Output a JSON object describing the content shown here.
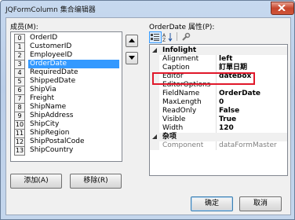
{
  "window": {
    "title": "JQFormColumn 集合编辑器"
  },
  "members": {
    "label": "成员(M):",
    "items": [
      {
        "index": "0",
        "name": "OrderID"
      },
      {
        "index": "1",
        "name": "CustomerID"
      },
      {
        "index": "2",
        "name": "EmployeeID"
      },
      {
        "index": "3",
        "name": "OrderDate"
      },
      {
        "index": "4",
        "name": "RequiredDate"
      },
      {
        "index": "5",
        "name": "ShippedDate"
      },
      {
        "index": "6",
        "name": "ShipVia"
      },
      {
        "index": "7",
        "name": "Freight"
      },
      {
        "index": "8",
        "name": "ShipName"
      },
      {
        "index": "9",
        "name": "ShipAddress"
      },
      {
        "index": "10",
        "name": "ShipCity"
      },
      {
        "index": "11",
        "name": "ShipRegion"
      },
      {
        "index": "12",
        "name": "ShipPostalCode"
      },
      {
        "index": "13",
        "name": "ShipCountry"
      }
    ],
    "selected_index": 3
  },
  "buttons": {
    "add": "添加(A)",
    "remove": "移除(R)",
    "ok": "确定",
    "cancel": "取消"
  },
  "properties": {
    "label": "OrderDate 属性(P):",
    "categories": [
      {
        "name": "Infolight",
        "rows": [
          {
            "name": "Alignment",
            "value": "left"
          },
          {
            "name": "Caption",
            "value": "訂單日期"
          },
          {
            "name": "Editor",
            "value": "datebox"
          },
          {
            "name": "EditorOptions",
            "value": ""
          },
          {
            "name": "FieldName",
            "value": "OrderDate"
          },
          {
            "name": "MaxLength",
            "value": "0"
          },
          {
            "name": "ReadOnly",
            "value": "False"
          },
          {
            "name": "Visible",
            "value": "True"
          },
          {
            "name": "Width",
            "value": "120"
          }
        ]
      },
      {
        "name": "杂项",
        "rows": [
          {
            "name": "Component",
            "value": "dataFormMaster"
          }
        ]
      }
    ]
  },
  "colors": {
    "selection": "#3399ff",
    "highlight_box": "#e0182a"
  }
}
